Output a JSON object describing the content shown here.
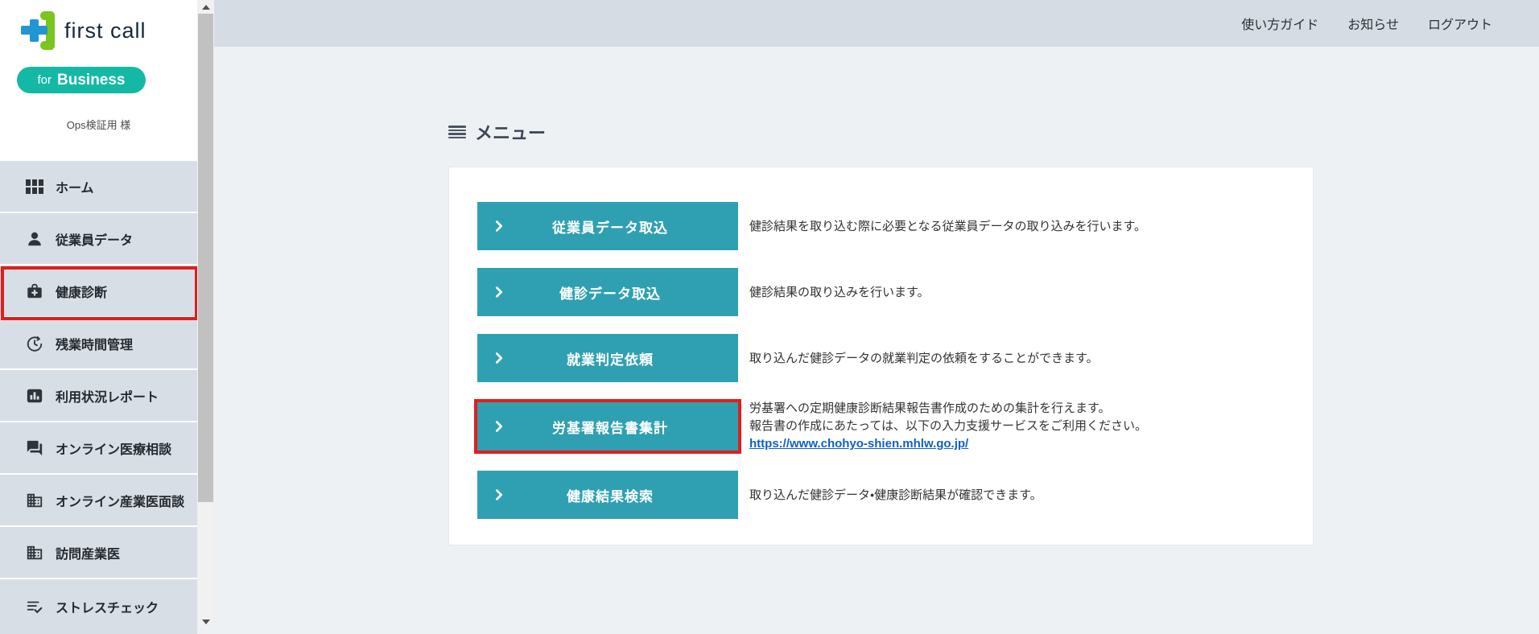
{
  "brand": {
    "name": "first call",
    "badge_for": "for",
    "badge_business": "Business",
    "user": "Ops検証用 様"
  },
  "topbar": {
    "links": [
      {
        "label": "使い方ガイド"
      },
      {
        "label": "お知らせ"
      },
      {
        "label": "ログアウト"
      }
    ]
  },
  "sidebar": {
    "items": [
      {
        "label": "ホーム",
        "icon": "grid-icon",
        "highlighted": false
      },
      {
        "label": "従業員データ",
        "icon": "person-icon",
        "highlighted": false
      },
      {
        "label": "健康診断",
        "icon": "medical-bag-icon",
        "highlighted": true
      },
      {
        "label": "残業時間管理",
        "icon": "clock-refresh-icon",
        "highlighted": false
      },
      {
        "label": "利用状況レポート",
        "icon": "bar-chart-icon",
        "highlighted": false
      },
      {
        "label": "オンライン医療相談",
        "icon": "chat-icon",
        "highlighted": false
      },
      {
        "label": "オンライン産業医面談",
        "icon": "building-icon",
        "highlighted": false
      },
      {
        "label": "訪問産業医",
        "icon": "building-icon",
        "highlighted": false
      },
      {
        "label": "ストレスチェック",
        "icon": "list-check-icon",
        "highlighted": false
      }
    ]
  },
  "main": {
    "title": "メニュー",
    "menu_items": [
      {
        "label": "従業員データ取込",
        "description": "健診結果を取り込む際に必要となる従業員データの取り込みを行います。",
        "highlighted": false
      },
      {
        "label": "健診データ取込",
        "description": "健診結果の取り込みを行います。",
        "highlighted": false
      },
      {
        "label": "就業判定依頼",
        "description": "取り込んだ健診データの就業判定の依頼をすることができます。",
        "highlighted": false
      },
      {
        "label": "労基署報告書集計",
        "description_line1": "労基署への定期健康診断結果報告書作成のための集計を行えます。",
        "description_line2": "報告書の作成にあたっては、以下の入力支援サービスをご利用ください。",
        "link": "https://www.chohyo-shien.mhlw.go.jp/",
        "highlighted": true
      },
      {
        "label": "健康結果検索",
        "description": "取り込んだ健診データ・健康診断結果が確認できます。",
        "highlighted": false
      }
    ]
  },
  "colors": {
    "accent_teal": "#2FA0B2",
    "brand_badge_teal": "#14B9A6",
    "highlight_red": "#E01E1E",
    "link_blue": "#0E61C8",
    "logo_blue": "#2196D3",
    "logo_green": "#7CC41E",
    "topbar_bg": "#D6DCE3",
    "sidebar_item_bg": "#D8DEE5",
    "content_bg": "#EEF1F4"
  }
}
